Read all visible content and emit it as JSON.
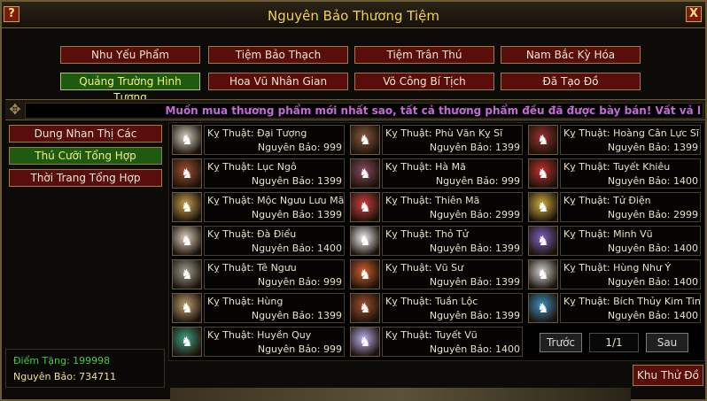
{
  "window": {
    "title": "Nguyên Bảo Thương Tiệm",
    "help_label": "?",
    "close_label": "X"
  },
  "categories": [
    {
      "label": "Nhu Yếu Phẩm",
      "active": false
    },
    {
      "label": "Tiệm Bảo Thạch",
      "active": false
    },
    {
      "label": "Tiệm Trân Thú",
      "active": false
    },
    {
      "label": "Nam Bắc Kỳ Hóa",
      "active": false
    },
    {
      "label": "Quảng Trường Hình Tượng",
      "active": true
    },
    {
      "label": "Hoa Vũ Nhân Gian",
      "active": false
    },
    {
      "label": "Võ Công Bí Tịch",
      "active": false
    },
    {
      "label": "Đã Tạo Đồ",
      "active": false
    }
  ],
  "marquee": "Muốn mua thương phẩm mới nhất sao, tất cả thương phẩm đều đã được bày bán! Vất vả l",
  "sidebar": [
    {
      "label": "Dung Nhan Thị Các",
      "active": false
    },
    {
      "label": "Thú Cưỡi Tổng Hợp",
      "active": true
    },
    {
      "label": "Thời Trang Tổng Hợp",
      "active": false
    }
  ],
  "items": [
    {
      "name": "Kỵ Thuật: Đại Tượng",
      "price": "Nguyên Bảo: 999",
      "icon": "elephant-icon",
      "color": "#d6d0c4"
    },
    {
      "name": "Kỵ Thuật: Phù Văn Kỵ Sĩ",
      "price": "Nguyên Bảo: 1399",
      "icon": "rune-knight-icon",
      "color": "#8a5a40"
    },
    {
      "name": "Kỵ Thuật: Hoàng Cân Lực Sĩ",
      "price": "Nguyên Bảo: 1399",
      "icon": "yellow-turban-icon",
      "color": "#9a3030"
    },
    {
      "name": "Kỵ Thuật: Lục Ngô",
      "price": "Nguyên Bảo: 1399",
      "icon": "luwu-beast-icon",
      "color": "#a05030"
    },
    {
      "name": "Kỵ Thuật: Hà Mã",
      "price": "Nguyên Bảo: 999",
      "icon": "hippo-icon",
      "color": "#8a4a60"
    },
    {
      "name": "Kỵ Thuật: Tuyết Khiêu",
      "price": "Nguyên Bảo: 1400",
      "icon": "snow-leopard-icon",
      "color": "#c03030"
    },
    {
      "name": "Kỵ Thuật: Mộc Ngưu Lưu Mã",
      "price": "Nguyên Bảo: 1399",
      "icon": "wooden-ox-icon",
      "color": "#c8a050"
    },
    {
      "name": "Kỵ Thuật: Thiên Mã",
      "price": "Nguyên Bảo: 2999",
      "icon": "pegasus-icon",
      "color": "#d04040"
    },
    {
      "name": "Kỵ Thuật: Tử Điện",
      "price": "Nguyên Bảo: 2999",
      "icon": "purple-lightning-icon",
      "color": "#d0b040"
    },
    {
      "name": "Kỵ Thuật: Đà Điểu",
      "price": "Nguyên Bảo: 1400",
      "icon": "ostrich-icon",
      "color": "#e0d0c0"
    },
    {
      "name": "Kỵ Thuật: Thỏ Tử",
      "price": "Nguyên Bảo: 1399",
      "icon": "rabbit-icon",
      "color": "#f0f0f0"
    },
    {
      "name": "Kỵ Thuật: Minh Vũ",
      "price": "Nguyên Bảo: 1400",
      "icon": "dark-wing-icon",
      "color": "#8060c0"
    },
    {
      "name": "Kỵ Thuật: Tê Ngưu",
      "price": "Nguyên Bảo: 999",
      "icon": "rhino-icon",
      "color": "#a0a090"
    },
    {
      "name": "Kỵ Thuật: Vũ Sư",
      "price": "Nguyên Bảo: 1399",
      "icon": "lion-dance-icon",
      "color": "#d06030"
    },
    {
      "name": "Kỵ Thuật: Hùng Như Ý",
      "price": "Nguyên Bảo: 1400",
      "icon": "bear-icon",
      "color": "#d0d0d0"
    },
    {
      "name": "Kỵ Thuật: Hùng",
      "price": "Nguyên Bảo: 1399",
      "icon": "warbear-icon",
      "color": "#c0a070"
    },
    {
      "name": "Kỵ Thuật: Tuần Lộc",
      "price": "Nguyên Bảo: 1399",
      "icon": "reindeer-icon",
      "color": "#a05030"
    },
    {
      "name": "Kỵ Thuật: Bích Thủy Kim Tinh",
      "price": "Nguyên Bảo: 1400",
      "icon": "water-beast-icon",
      "color": "#4090c0"
    },
    {
      "name": "Kỵ Thuật: Huyền Quy",
      "price": "Nguyên Bảo: 999",
      "icon": "black-tortoise-icon",
      "color": "#40a080"
    },
    {
      "name": "Kỵ Thuật: Tuyết Vũ",
      "price": "Nguyên Bảo: 1400",
      "icon": "snow-wing-icon",
      "color": "#c0b0f0"
    }
  ],
  "pagination": {
    "prev_label": "Trước",
    "page": "1/1",
    "next_label": "Sau"
  },
  "info": {
    "bonus": "Điểm Tặng: 199998",
    "balance": "Nguyên Bảo: 734711"
  },
  "storage_label": "Khu Thử Đồ"
}
